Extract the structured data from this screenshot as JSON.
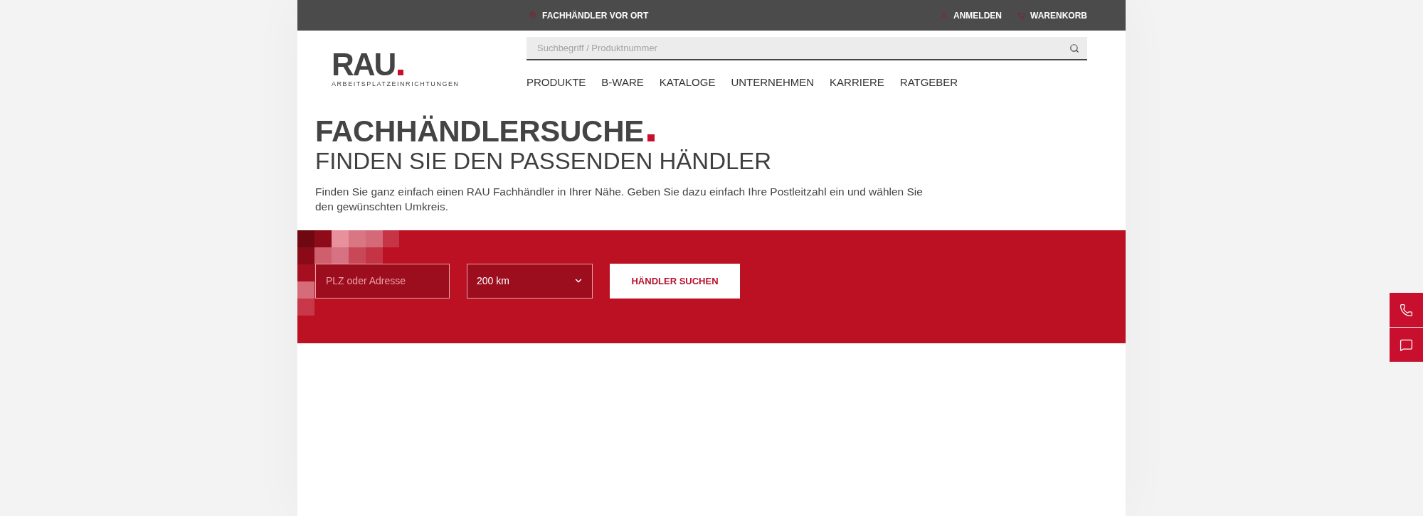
{
  "top_bar": {
    "service_link": {
      "kind": "location",
      "label": "FACHHÄNDLER VOR ORT"
    },
    "account_links": [
      {
        "kind": "account",
        "label": "ANMELDEN"
      },
      {
        "kind": "cart",
        "label": "WARENKORB"
      }
    ]
  },
  "logo": {
    "name": "RAU",
    "tagline": "ARBEITSPLATZEINRICHTUNGEN"
  },
  "search": {
    "placeholder": "Suchbegriff / Produktnummer"
  },
  "nav": [
    {
      "label": "PRODUKTE"
    },
    {
      "label": "B-WARE"
    },
    {
      "label": "KATALOGE"
    },
    {
      "label": "UNTERNEHMEN"
    },
    {
      "label": "KARRIERE"
    },
    {
      "label": "RATGEBER"
    }
  ],
  "intro": {
    "title": "FACHHÄNDLERSUCHE",
    "subtitle": "FINDEN SIE DEN PASSENDEN HÄNDLER",
    "text": "Finden Sie ganz einfach einen RAU Fachhändler in Ihrer Nähe. Geben Sie dazu einfach Ihre Postleitzahl ein und wählen Sie den gewünschten Umkreis."
  },
  "dealer_search": {
    "address_field": {
      "placeholder": "PLZ oder Adresse"
    },
    "radius": {
      "value": "200 km"
    },
    "submit": {
      "label": "HÄNDLER SUCHEN"
    }
  },
  "side_buttons": [
    {
      "kind": "phone"
    },
    {
      "kind": "chat"
    }
  ]
}
